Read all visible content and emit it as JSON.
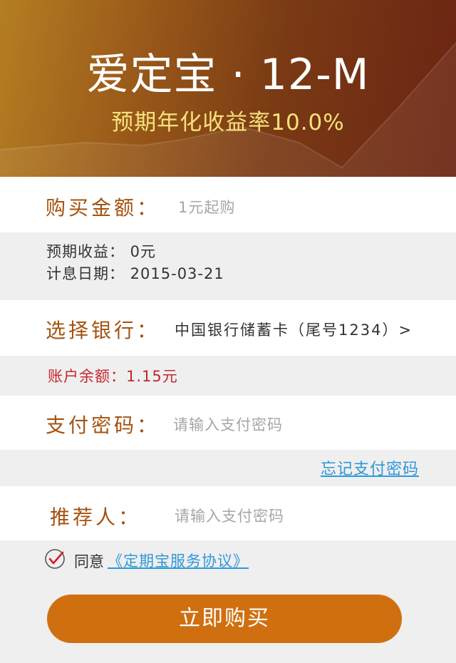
{
  "header": {
    "title": "爱定宝 · 12-M",
    "subtitle": "预期年化收益率10.0%"
  },
  "purchase": {
    "label": "购买金额：",
    "placeholder": "1元起购"
  },
  "summary": {
    "expected_income": "预期收益：   0元",
    "interest_date": "计息日期：   2015-03-21"
  },
  "bank": {
    "label": "选择银行：",
    "value": "中国银行储蓄卡（尾号1234）>"
  },
  "account": {
    "balance": "账户余额：1.15元"
  },
  "password": {
    "label": "支付密码：",
    "placeholder": "请输入支付密码",
    "forgot": "忘记支付密码"
  },
  "referrer": {
    "label": "推荐人：",
    "placeholder": "请输入支付密码"
  },
  "agreement": {
    "prefix": "同意",
    "link": "《定期宝服务协议》",
    "checked": true
  },
  "buy_button": "立即购买",
  "colors": {
    "accent": "#d06f10",
    "label": "#a4520f",
    "balance": "#c2272d",
    "link": "#2f98d8",
    "subtitle": "#f7e27a"
  }
}
